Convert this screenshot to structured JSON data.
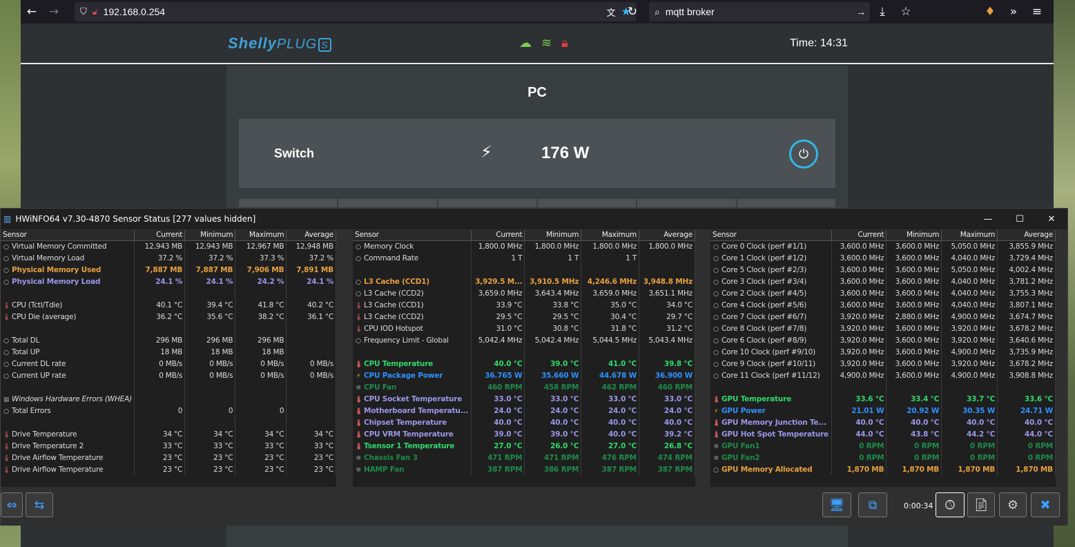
{
  "browser": {
    "url": "192.168.0.254",
    "search": "mqtt broker"
  },
  "shelly": {
    "logo_brand": "Shelly",
    "logo_product": "PLUG",
    "logo_suffix": "S",
    "time": "Time: 14:31",
    "device_title": "PC",
    "switch_label": "Switch",
    "power": "176 W"
  },
  "hwinfo": {
    "title": "HWiNFO64 v7.30-4870 Sensor Status [277 values hidden]",
    "timer": "0:00:34",
    "headers": [
      "Sensor",
      "Current",
      "Minimum",
      "Maximum",
      "Average"
    ],
    "panel1": [
      {
        "icon": "circle",
        "name": "Virtual Memory Committed",
        "cur": "12,943 MB",
        "min": "12,943 MB",
        "max": "12,967 MB",
        "avg": "12,948 MB",
        "style": ""
      },
      {
        "icon": "circle",
        "name": "Virtual Memory Load",
        "cur": "37.2 %",
        "min": "37.2 %",
        "max": "37.3 %",
        "avg": "37.2 %",
        "style": ""
      },
      {
        "icon": "circle",
        "name": "Physical Memory Used",
        "cur": "7,887 MB",
        "min": "7,887 MB",
        "max": "7,906 MB",
        "avg": "7,891 MB",
        "style": "c-orange"
      },
      {
        "icon": "circle",
        "name": "Physical Memory Load",
        "cur": "24.1 %",
        "min": "24.1 %",
        "max": "24.2 %",
        "avg": "24.1 %",
        "style": "c-purple"
      },
      {
        "icon": "",
        "name": "",
        "cur": "",
        "min": "",
        "max": "",
        "avg": "",
        "style": ""
      },
      {
        "icon": "therm",
        "name": "CPU (Tctl/Tdie)",
        "cur": "40.1 °C",
        "min": "39.4 °C",
        "max": "41.8 °C",
        "avg": "40.2 °C",
        "style": ""
      },
      {
        "icon": "therm",
        "name": "CPU Die (average)",
        "cur": "36.2 °C",
        "min": "35.6 °C",
        "max": "38.2 °C",
        "avg": "36.1 °C",
        "style": ""
      },
      {
        "icon": "",
        "name": "",
        "cur": "",
        "min": "",
        "max": "",
        "avg": "",
        "style": ""
      },
      {
        "icon": "circle",
        "name": "Total DL",
        "cur": "296 MB",
        "min": "296 MB",
        "max": "296 MB",
        "avg": "",
        "style": ""
      },
      {
        "icon": "circle",
        "name": "Total UP",
        "cur": "18 MB",
        "min": "18 MB",
        "max": "18 MB",
        "avg": "",
        "style": ""
      },
      {
        "icon": "circle",
        "name": "Current DL rate",
        "cur": "0 MB/s",
        "min": "0 MB/s",
        "max": "0 MB/s",
        "avg": "0 MB/s",
        "style": ""
      },
      {
        "icon": "circle",
        "name": "Current UP rate",
        "cur": "0 MB/s",
        "min": "0 MB/s",
        "max": "0 MB/s",
        "avg": "0 MB/s",
        "style": ""
      },
      {
        "icon": "",
        "name": "",
        "cur": "",
        "min": "",
        "max": "",
        "avg": "",
        "style": ""
      },
      {
        "icon": "box",
        "name": "Windows Hardware Errors (WHEA)",
        "cur": "",
        "min": "",
        "max": "",
        "avg": "",
        "style": "c-italic"
      },
      {
        "icon": "circle",
        "name": "Total Errors",
        "cur": "0",
        "min": "0",
        "max": "0",
        "avg": "",
        "style": ""
      },
      {
        "icon": "",
        "name": "",
        "cur": "",
        "min": "",
        "max": "",
        "avg": "",
        "style": ""
      },
      {
        "icon": "therm",
        "name": "Drive Temperature",
        "cur": "34 °C",
        "min": "34 °C",
        "max": "34 °C",
        "avg": "34 °C",
        "style": ""
      },
      {
        "icon": "therm",
        "name": "Drive Temperature 2",
        "cur": "33 °C",
        "min": "33 °C",
        "max": "33 °C",
        "avg": "33 °C",
        "style": ""
      },
      {
        "icon": "therm",
        "name": "Drive Airflow Temperature",
        "cur": "23 °C",
        "min": "23 °C",
        "max": "23 °C",
        "avg": "23 °C",
        "style": ""
      },
      {
        "icon": "therm",
        "name": "Drive Airflow Temperature",
        "cur": "23 °C",
        "min": "23 °C",
        "max": "23 °C",
        "avg": "23 °C",
        "style": ""
      }
    ],
    "panel2": [
      {
        "icon": "circle",
        "name": "Memory Clock",
        "cur": "1,800.0 MHz",
        "min": "1,800.0 MHz",
        "max": "1,800.0 MHz",
        "avg": "1,800.0 MHz",
        "style": ""
      },
      {
        "icon": "circle",
        "name": "Command Rate",
        "cur": "1 T",
        "min": "1 T",
        "max": "1 T",
        "avg": "",
        "style": ""
      },
      {
        "icon": "",
        "name": "",
        "cur": "",
        "min": "",
        "max": "",
        "avg": "",
        "style": ""
      },
      {
        "icon": "circle",
        "name": "L3 Cache (CCD1)",
        "cur": "3,929.5 M...",
        "min": "3,910.5 MHz",
        "max": "4,246.6 MHz",
        "avg": "3,948.8 MHz",
        "style": "c-orange"
      },
      {
        "icon": "circle",
        "name": "L3 Cache (CCD2)",
        "cur": "3,659.0 MHz",
        "min": "3,643.4 MHz",
        "max": "3,659.0 MHz",
        "avg": "3,651.1 MHz",
        "style": ""
      },
      {
        "icon": "therm",
        "name": "L3 Cache (CCD1)",
        "cur": "33.9 °C",
        "min": "33.8 °C",
        "max": "35.0 °C",
        "avg": "34.0 °C",
        "style": ""
      },
      {
        "icon": "therm",
        "name": "L3 Cache (CCD2)",
        "cur": "29.5 °C",
        "min": "29.5 °C",
        "max": "30.4 °C",
        "avg": "29.7 °C",
        "style": ""
      },
      {
        "icon": "therm",
        "name": "CPU IOD Hotspot",
        "cur": "31.0 °C",
        "min": "30.8 °C",
        "max": "31.8 °C",
        "avg": "31.2 °C",
        "style": ""
      },
      {
        "icon": "circle",
        "name": "Frequency Limit - Global",
        "cur": "5,042.4 MHz",
        "min": "5,042.4 MHz",
        "max": "5,044.5 MHz",
        "avg": "5,043.4 MHz",
        "style": ""
      },
      {
        "icon": "",
        "name": "",
        "cur": "",
        "min": "",
        "max": "",
        "avg": "",
        "style": ""
      },
      {
        "icon": "therm",
        "name": "CPU Temperature",
        "cur": "40.0 °C",
        "min": "39.0 °C",
        "max": "41.0 °C",
        "avg": "39.8 °C",
        "style": "c-green"
      },
      {
        "icon": "bolt",
        "name": "CPU Package Power",
        "cur": "36.765 W",
        "min": "35.660 W",
        "max": "44.678 W",
        "avg": "36.900 W",
        "style": "c-blue"
      },
      {
        "icon": "fan",
        "name": "CPU Fan",
        "cur": "460 RPM",
        "min": "458 RPM",
        "max": "462 RPM",
        "avg": "460 RPM",
        "style": "c-dgreen"
      },
      {
        "icon": "therm",
        "name": "CPU Socket Temperature",
        "cur": "33.0 °C",
        "min": "33.0 °C",
        "max": "33.0 °C",
        "avg": "33.0 °C",
        "style": "c-purple"
      },
      {
        "icon": "therm",
        "name": "Motherboard Temperatu...",
        "cur": "24.0 °C",
        "min": "24.0 °C",
        "max": "24.0 °C",
        "avg": "24.0 °C",
        "style": "c-purple"
      },
      {
        "icon": "therm",
        "name": "Chipset Temperature",
        "cur": "40.0 °C",
        "min": "40.0 °C",
        "max": "40.0 °C",
        "avg": "40.0 °C",
        "style": "c-purple"
      },
      {
        "icon": "therm",
        "name": "CPU VRM Temperature",
        "cur": "39.0 °C",
        "min": "39.0 °C",
        "max": "40.0 °C",
        "avg": "39.2 °C",
        "style": "c-purple"
      },
      {
        "icon": "therm",
        "name": "Tsensor 1 Temperature",
        "cur": "27.0 °C",
        "min": "26.0 °C",
        "max": "27.0 °C",
        "avg": "26.8 °C",
        "style": "c-green"
      },
      {
        "icon": "fan",
        "name": "Chassis Fan 3",
        "cur": "471 RPM",
        "min": "471 RPM",
        "max": "476 RPM",
        "avg": "474 RPM",
        "style": "c-dgreen"
      },
      {
        "icon": "fan",
        "name": "HAMP Fan",
        "cur": "387 RPM",
        "min": "386 RPM",
        "max": "387 RPM",
        "avg": "387 RPM",
        "style": "c-dgreen"
      }
    ],
    "panel3": [
      {
        "icon": "circle",
        "name": "Core 0 Clock (perf #1/1)",
        "cur": "3,600.0 MHz",
        "min": "3,600.0 MHz",
        "max": "5,050.0 MHz",
        "avg": "3,855.9 MHz",
        "style": ""
      },
      {
        "icon": "circle",
        "name": "Core 1 Clock (perf #1/2)",
        "cur": "3,600.0 MHz",
        "min": "3,600.0 MHz",
        "max": "4,040.0 MHz",
        "avg": "3,729.4 MHz",
        "style": ""
      },
      {
        "icon": "circle",
        "name": "Core 5 Clock (perf #2/3)",
        "cur": "3,600.0 MHz",
        "min": "3,600.0 MHz",
        "max": "5,050.0 MHz",
        "avg": "4,002.4 MHz",
        "style": ""
      },
      {
        "icon": "circle",
        "name": "Core 3 Clock (perf #3/4)",
        "cur": "3,600.0 MHz",
        "min": "3,600.0 MHz",
        "max": "4,040.0 MHz",
        "avg": "3,781.2 MHz",
        "style": ""
      },
      {
        "icon": "circle",
        "name": "Core 2 Clock (perf #4/5)",
        "cur": "3,600.0 MHz",
        "min": "3,600.0 MHz",
        "max": "4,040.0 MHz",
        "avg": "3,755.3 MHz",
        "style": ""
      },
      {
        "icon": "circle",
        "name": "Core 4 Clock (perf #5/6)",
        "cur": "3,600.0 MHz",
        "min": "3,600.0 MHz",
        "max": "4,040.0 MHz",
        "avg": "3,807.1 MHz",
        "style": ""
      },
      {
        "icon": "circle",
        "name": "Core 7 Clock (perf #6/7)",
        "cur": "3,920.0 MHz",
        "min": "2,880.0 MHz",
        "max": "4,900.0 MHz",
        "avg": "3,674.7 MHz",
        "style": ""
      },
      {
        "icon": "circle",
        "name": "Core 8 Clock (perf #7/8)",
        "cur": "3,920.0 MHz",
        "min": "3,600.0 MHz",
        "max": "3,920.0 MHz",
        "avg": "3,678.2 MHz",
        "style": ""
      },
      {
        "icon": "circle",
        "name": "Core 6 Clock (perf #8/9)",
        "cur": "3,920.0 MHz",
        "min": "3,600.0 MHz",
        "max": "3,920.0 MHz",
        "avg": "3,640.6 MHz",
        "style": ""
      },
      {
        "icon": "circle",
        "name": "Core 10 Clock (perf #9/10)",
        "cur": "3,920.0 MHz",
        "min": "3,600.0 MHz",
        "max": "4,900.0 MHz",
        "avg": "3,735.9 MHz",
        "style": ""
      },
      {
        "icon": "circle",
        "name": "Core 9 Clock (perf #10/11)",
        "cur": "3,920.0 MHz",
        "min": "3,600.0 MHz",
        "max": "3,920.0 MHz",
        "avg": "3,678.2 MHz",
        "style": ""
      },
      {
        "icon": "circle",
        "name": "Core 11 Clock (perf #11/12)",
        "cur": "4,900.0 MHz",
        "min": "3,600.0 MHz",
        "max": "4,900.0 MHz",
        "avg": "3,908.8 MHz",
        "style": ""
      },
      {
        "icon": "",
        "name": "",
        "cur": "",
        "min": "",
        "max": "",
        "avg": "",
        "style": ""
      },
      {
        "icon": "therm",
        "name": "GPU Temperature",
        "cur": "33.6 °C",
        "min": "33.4 °C",
        "max": "33.7 °C",
        "avg": "33.6 °C",
        "style": "c-green"
      },
      {
        "icon": "bolt",
        "name": "GPU Power",
        "cur": "21.01 W",
        "min": "20.92 W",
        "max": "30.35 W",
        "avg": "24.71 W",
        "style": "c-blue"
      },
      {
        "icon": "therm",
        "name": "GPU Memory Junction Te...",
        "cur": "40.0 °C",
        "min": "40.0 °C",
        "max": "40.0 °C",
        "avg": "40.0 °C",
        "style": "c-purple"
      },
      {
        "icon": "therm",
        "name": "GPU Hot Spot Temperature",
        "cur": "44.0 °C",
        "min": "43.8 °C",
        "max": "44.2 °C",
        "avg": "44.0 °C",
        "style": "c-purple"
      },
      {
        "icon": "fan",
        "name": "GPU Fan1",
        "cur": "0 RPM",
        "min": "0 RPM",
        "max": "0 RPM",
        "avg": "0 RPM",
        "style": "c-dgreen"
      },
      {
        "icon": "fan",
        "name": "GPU Fan2",
        "cur": "0 RPM",
        "min": "0 RPM",
        "max": "0 RPM",
        "avg": "0 RPM",
        "style": "c-dgreen"
      },
      {
        "icon": "circle",
        "name": "GPU Memory Allocated",
        "cur": "1,870 MB",
        "min": "1,870 MB",
        "max": "1,870 MB",
        "avg": "1,870 MB",
        "style": "c-orange"
      }
    ]
  }
}
